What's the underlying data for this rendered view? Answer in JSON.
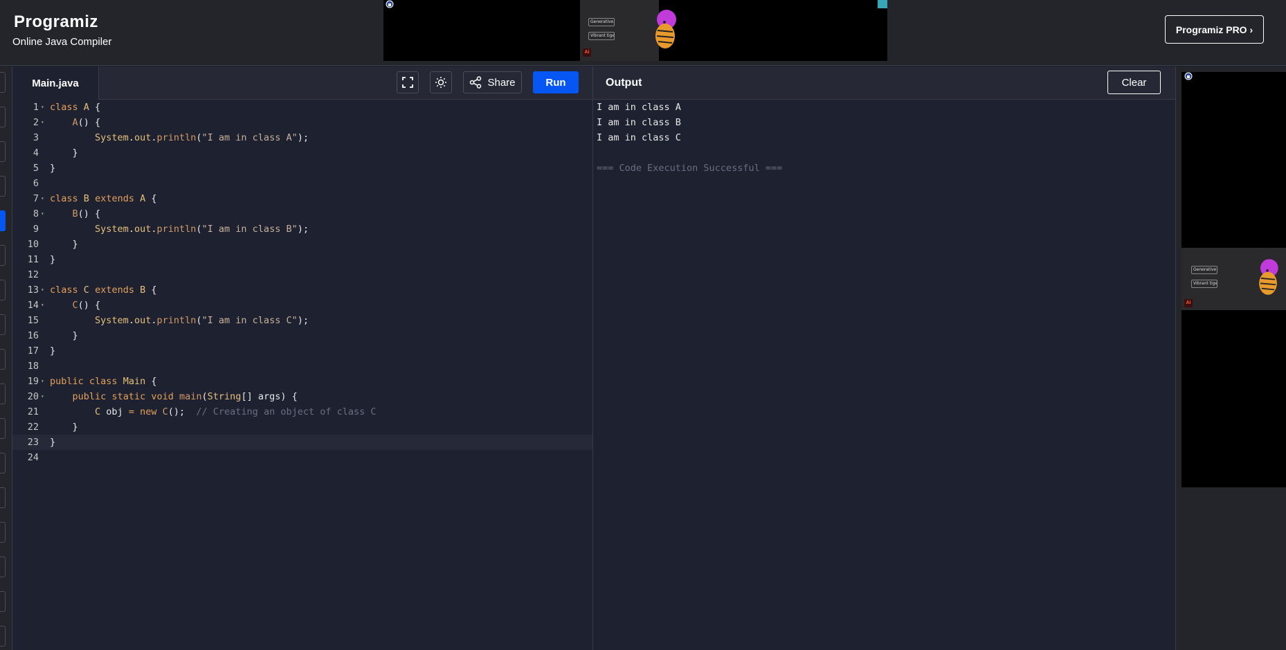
{
  "header": {
    "logo": "Programiz",
    "subtitle": "Online Java Compiler",
    "pro_button": "Programiz PRO ›"
  },
  "ads": {
    "tag1": "Generative vector",
    "tag2": "Vibrant tiger mirror",
    "ai_badge": "Ai"
  },
  "editor": {
    "file_tab": "Main.java",
    "share_label": "Share",
    "run_label": "Run",
    "lines": [
      {
        "n": "1",
        "fold": true,
        "tokens": [
          [
            "kw",
            "class"
          ],
          [
            "pl",
            " "
          ],
          [
            "id",
            "A"
          ],
          [
            "pl",
            " {"
          ]
        ]
      },
      {
        "n": "2",
        "fold": true,
        "tokens": [
          [
            "pl",
            "    "
          ],
          [
            "fn",
            "A"
          ],
          [
            "pl",
            "() {"
          ]
        ]
      },
      {
        "n": "3",
        "fold": false,
        "tokens": [
          [
            "pl",
            "        "
          ],
          [
            "id",
            "System"
          ],
          [
            "pl",
            "."
          ],
          [
            "id",
            "out"
          ],
          [
            "pl",
            "."
          ],
          [
            "fn",
            "println"
          ],
          [
            "pl",
            "("
          ],
          [
            "str",
            "\"I am in class A\""
          ],
          [
            "pl",
            ");"
          ]
        ]
      },
      {
        "n": "4",
        "fold": false,
        "tokens": [
          [
            "pl",
            "    }"
          ]
        ]
      },
      {
        "n": "5",
        "fold": false,
        "tokens": [
          [
            "pl",
            "}"
          ]
        ]
      },
      {
        "n": "6",
        "fold": false,
        "tokens": []
      },
      {
        "n": "7",
        "fold": true,
        "tokens": [
          [
            "kw",
            "class"
          ],
          [
            "pl",
            " "
          ],
          [
            "id",
            "B"
          ],
          [
            "pl",
            " "
          ],
          [
            "kw",
            "extends"
          ],
          [
            "pl",
            " "
          ],
          [
            "id",
            "A"
          ],
          [
            "pl",
            " {"
          ]
        ]
      },
      {
        "n": "8",
        "fold": true,
        "tokens": [
          [
            "pl",
            "    "
          ],
          [
            "fn",
            "B"
          ],
          [
            "pl",
            "() {"
          ]
        ]
      },
      {
        "n": "9",
        "fold": false,
        "tokens": [
          [
            "pl",
            "        "
          ],
          [
            "id",
            "System"
          ],
          [
            "pl",
            "."
          ],
          [
            "id",
            "out"
          ],
          [
            "pl",
            "."
          ],
          [
            "fn",
            "println"
          ],
          [
            "pl",
            "("
          ],
          [
            "str",
            "\"I am in class B\""
          ],
          [
            "pl",
            ");"
          ]
        ]
      },
      {
        "n": "10",
        "fold": false,
        "tokens": [
          [
            "pl",
            "    }"
          ]
        ]
      },
      {
        "n": "11",
        "fold": false,
        "tokens": [
          [
            "pl",
            "}"
          ]
        ]
      },
      {
        "n": "12",
        "fold": false,
        "tokens": []
      },
      {
        "n": "13",
        "fold": true,
        "tokens": [
          [
            "kw",
            "class"
          ],
          [
            "pl",
            " "
          ],
          [
            "id",
            "C"
          ],
          [
            "pl",
            " "
          ],
          [
            "kw",
            "extends"
          ],
          [
            "pl",
            " "
          ],
          [
            "id",
            "B"
          ],
          [
            "pl",
            " {"
          ]
        ]
      },
      {
        "n": "14",
        "fold": true,
        "tokens": [
          [
            "pl",
            "    "
          ],
          [
            "fn",
            "C"
          ],
          [
            "pl",
            "() {"
          ]
        ]
      },
      {
        "n": "15",
        "fold": false,
        "tokens": [
          [
            "pl",
            "        "
          ],
          [
            "id",
            "System"
          ],
          [
            "pl",
            "."
          ],
          [
            "id",
            "out"
          ],
          [
            "pl",
            "."
          ],
          [
            "fn",
            "println"
          ],
          [
            "pl",
            "("
          ],
          [
            "str",
            "\"I am in class C\""
          ],
          [
            "pl",
            ");"
          ]
        ]
      },
      {
        "n": "16",
        "fold": false,
        "tokens": [
          [
            "pl",
            "    }"
          ]
        ]
      },
      {
        "n": "17",
        "fold": false,
        "tokens": [
          [
            "pl",
            "}"
          ]
        ]
      },
      {
        "n": "18",
        "fold": false,
        "tokens": []
      },
      {
        "n": "19",
        "fold": true,
        "tokens": [
          [
            "kw",
            "public"
          ],
          [
            "pl",
            " "
          ],
          [
            "kw",
            "class"
          ],
          [
            "pl",
            " "
          ],
          [
            "id",
            "Main"
          ],
          [
            "pl",
            " {"
          ]
        ]
      },
      {
        "n": "20",
        "fold": true,
        "tokens": [
          [
            "pl",
            "    "
          ],
          [
            "kw",
            "public"
          ],
          [
            "pl",
            " "
          ],
          [
            "kw",
            "static"
          ],
          [
            "pl",
            " "
          ],
          [
            "kw",
            "void"
          ],
          [
            "pl",
            " "
          ],
          [
            "fn",
            "main"
          ],
          [
            "pl",
            "("
          ],
          [
            "id",
            "String"
          ],
          [
            "pl",
            "[] args) {"
          ]
        ]
      },
      {
        "n": "21",
        "fold": false,
        "tokens": [
          [
            "pl",
            "        "
          ],
          [
            "id",
            "C"
          ],
          [
            "pl",
            " obj "
          ],
          [
            "kw",
            "="
          ],
          [
            "pl",
            " "
          ],
          [
            "kw",
            "new"
          ],
          [
            "pl",
            " "
          ],
          [
            "fn",
            "C"
          ],
          [
            "pl",
            "();  "
          ],
          [
            "cm",
            "// Creating an object of class C"
          ]
        ]
      },
      {
        "n": "22",
        "fold": false,
        "tokens": [
          [
            "pl",
            "    }"
          ]
        ]
      },
      {
        "n": "23",
        "fold": false,
        "tokens": [
          [
            "pl",
            "}"
          ]
        ]
      },
      {
        "n": "24",
        "fold": false,
        "tokens": []
      }
    ]
  },
  "output": {
    "title": "Output",
    "clear_label": "Clear",
    "lines": [
      "I am in class A",
      "I am in class B",
      "I am in class C",
      "",
      "=== Code Execution Successful ==="
    ]
  },
  "colors": {
    "accent": "#0556f3",
    "background": "#1e2130",
    "header_bg": "#23252b"
  }
}
